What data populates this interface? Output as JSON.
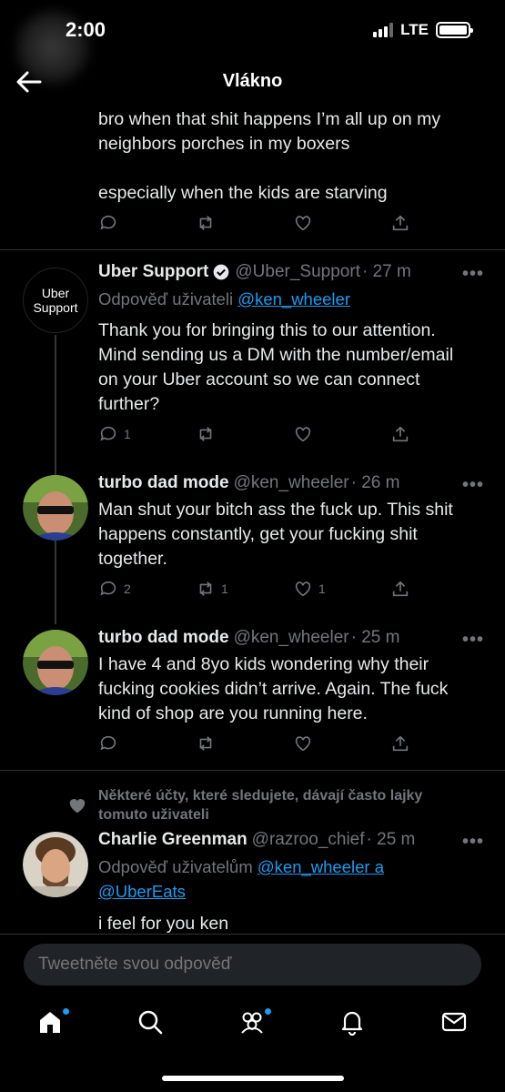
{
  "status": {
    "time": "2:00",
    "network": "LTE"
  },
  "header": {
    "title": "Vlákno"
  },
  "prev_tweet": {
    "lines": [
      "bro when that shit happens I’m all up on my",
      "neighbors porches in my boxers",
      "",
      "especially when the kids are starving"
    ]
  },
  "tweets": [
    {
      "name": "Uber Support",
      "handle": "@Uber_Support",
      "time": "· 27 m",
      "avatar_text": [
        "Uber",
        "Support"
      ],
      "reply_prefix": "Odpověď uživateli",
      "reply_targets": [
        "@ken_wheeler"
      ],
      "lines": [
        "Thank you for bringing this to our attention.",
        "Mind sending us a DM with the number/email",
        "on your Uber account so we can connect",
        "further?"
      ],
      "counts": {
        "reply": "1",
        "retweet": "",
        "like": ""
      }
    },
    {
      "name": "turbo dad mode",
      "handle": "@ken_wheeler",
      "time": "· 26 m",
      "lines": [
        "Man shut your bitch ass the fuck up. This shit",
        "happens constantly, get your fucking shit",
        "together."
      ],
      "counts": {
        "reply": "2",
        "retweet": "1",
        "like": "1"
      }
    },
    {
      "name": "turbo dad mode",
      "handle": "@ken_wheeler",
      "time": "· 25 m",
      "lines": [
        "I have 4 and 8yo kids wondering why their",
        "fucking cookies didn’t arrive. Again. The fuck",
        "kind of shop are you running here."
      ],
      "counts": {
        "reply": "",
        "retweet": "",
        "like": ""
      }
    },
    {
      "social_context": [
        "Některé účty, které sledujete, dávají často lajky",
        "tomuto uživateli"
      ],
      "name": "Charlie Greenman",
      "handle": "@razroo_chief",
      "time": "· 25 m",
      "reply_prefix": "Odpověď uživatelům",
      "reply_targets": [
        "@ken_wheeler a",
        "@UberEats"
      ],
      "lines": [
        "i feel for you ken"
      ]
    }
  ],
  "more_label": "•••",
  "reply_bar": {
    "placeholder": "Tweetněte svou odpověď"
  },
  "tabs": [
    "home-icon",
    "search-icon",
    "communities-icon",
    "notifications-icon",
    "messages-icon"
  ],
  "colors": {
    "accent": "#1d9bf0",
    "muted": "#71767b",
    "text": "#e7e9ea",
    "background": "#000000"
  }
}
